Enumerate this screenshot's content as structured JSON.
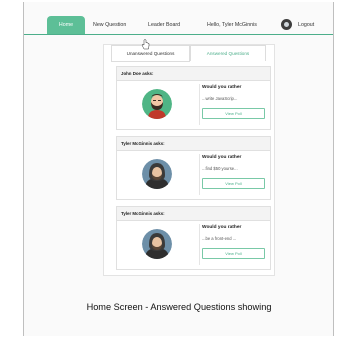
{
  "nav": {
    "home": "Home",
    "new_question": "New Question",
    "leader_board": "Leader Board",
    "hello": "Hello, Tyler McGinnis",
    "logout": "Logout"
  },
  "tabs": {
    "unanswered": "Unanswered Questions",
    "answered": "Answered Questions"
  },
  "cards": [
    {
      "author": "John Doe asks:",
      "title": "Would you rather",
      "snippet": "...write JavaScrip...",
      "button": "View Poll",
      "avatar": "bearded-man-avatar-icon"
    },
    {
      "author": "Tyler McGinnis asks:",
      "title": "Would you rather",
      "snippet": "...find $50 yourse...",
      "button": "View Poll",
      "avatar": "hooded-man-avatar-icon"
    },
    {
      "author": "Tyler McGinnis asks:",
      "title": "Would you rather",
      "snippet": "...be a front-end ...",
      "button": "View Poll",
      "avatar": "hooded-man-avatar-icon"
    }
  ],
  "caption": "Home Screen - Answered Questions showing",
  "colors": {
    "accent": "#5dbf97",
    "accent_text": "#4cae8a"
  }
}
